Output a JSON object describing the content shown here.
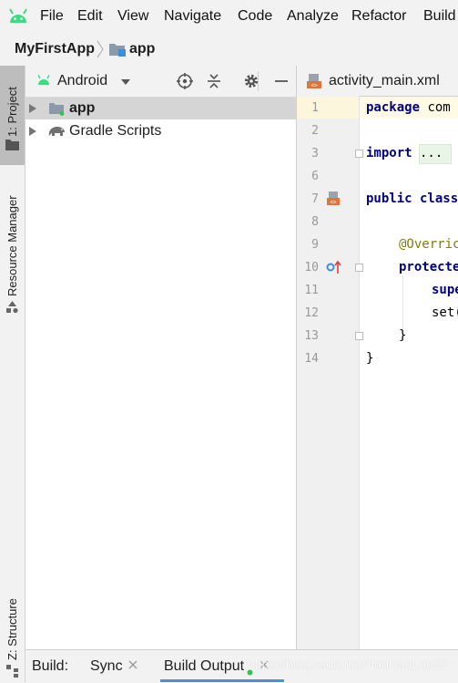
{
  "menubar": {
    "items": [
      "File",
      "Edit",
      "View",
      "Navigate",
      "Code",
      "Analyze",
      "Refactor",
      "Build"
    ],
    "accent": "#3ddc84"
  },
  "breadcrumb": {
    "project": "MyFirstApp",
    "module": "app"
  },
  "left_strip": {
    "project_tab": "1: Project",
    "resource_tab": "Resource Manager",
    "structure_tab": "Z: Structure"
  },
  "project_panel": {
    "view_selector": "Android",
    "tree": [
      {
        "label": "app",
        "selected": true,
        "icon": "module-folder-icon"
      },
      {
        "label": "Gradle Scripts",
        "selected": false,
        "icon": "gradle-elephant-icon"
      }
    ],
    "tools": [
      "locate-icon",
      "collapse-all-icon",
      "settings-gear-icon",
      "hide-minus-icon"
    ]
  },
  "editor": {
    "tab_label": "activity_main.xml",
    "line_numbers": [
      "1",
      "2",
      "3",
      "6",
      "7",
      "8",
      "9",
      "10",
      "11",
      "12",
      "13",
      "14"
    ],
    "lines": [
      {
        "kw": "package",
        "rest": " com"
      },
      {
        "kw": "",
        "rest": ""
      },
      {
        "kw": "import",
        "rest": " ..."
      },
      {
        "kw": "",
        "rest": ""
      },
      {
        "kw": "public class",
        "rest": ""
      },
      {
        "kw": "",
        "rest": ""
      },
      {
        "ann": "@Overric"
      },
      {
        "kw": "protecte",
        "rest": ""
      },
      {
        "kw": "supe",
        "rest": ""
      },
      {
        "plain": "set("
      },
      {
        "plain": "}"
      },
      {
        "plain": "}"
      }
    ]
  },
  "bottom_bar": {
    "build_label": "Build:",
    "sync_tab": "Sync",
    "output_tab": "Build Output",
    "watermark": "https://blog.csdn.net/NanHaoLuo23"
  }
}
